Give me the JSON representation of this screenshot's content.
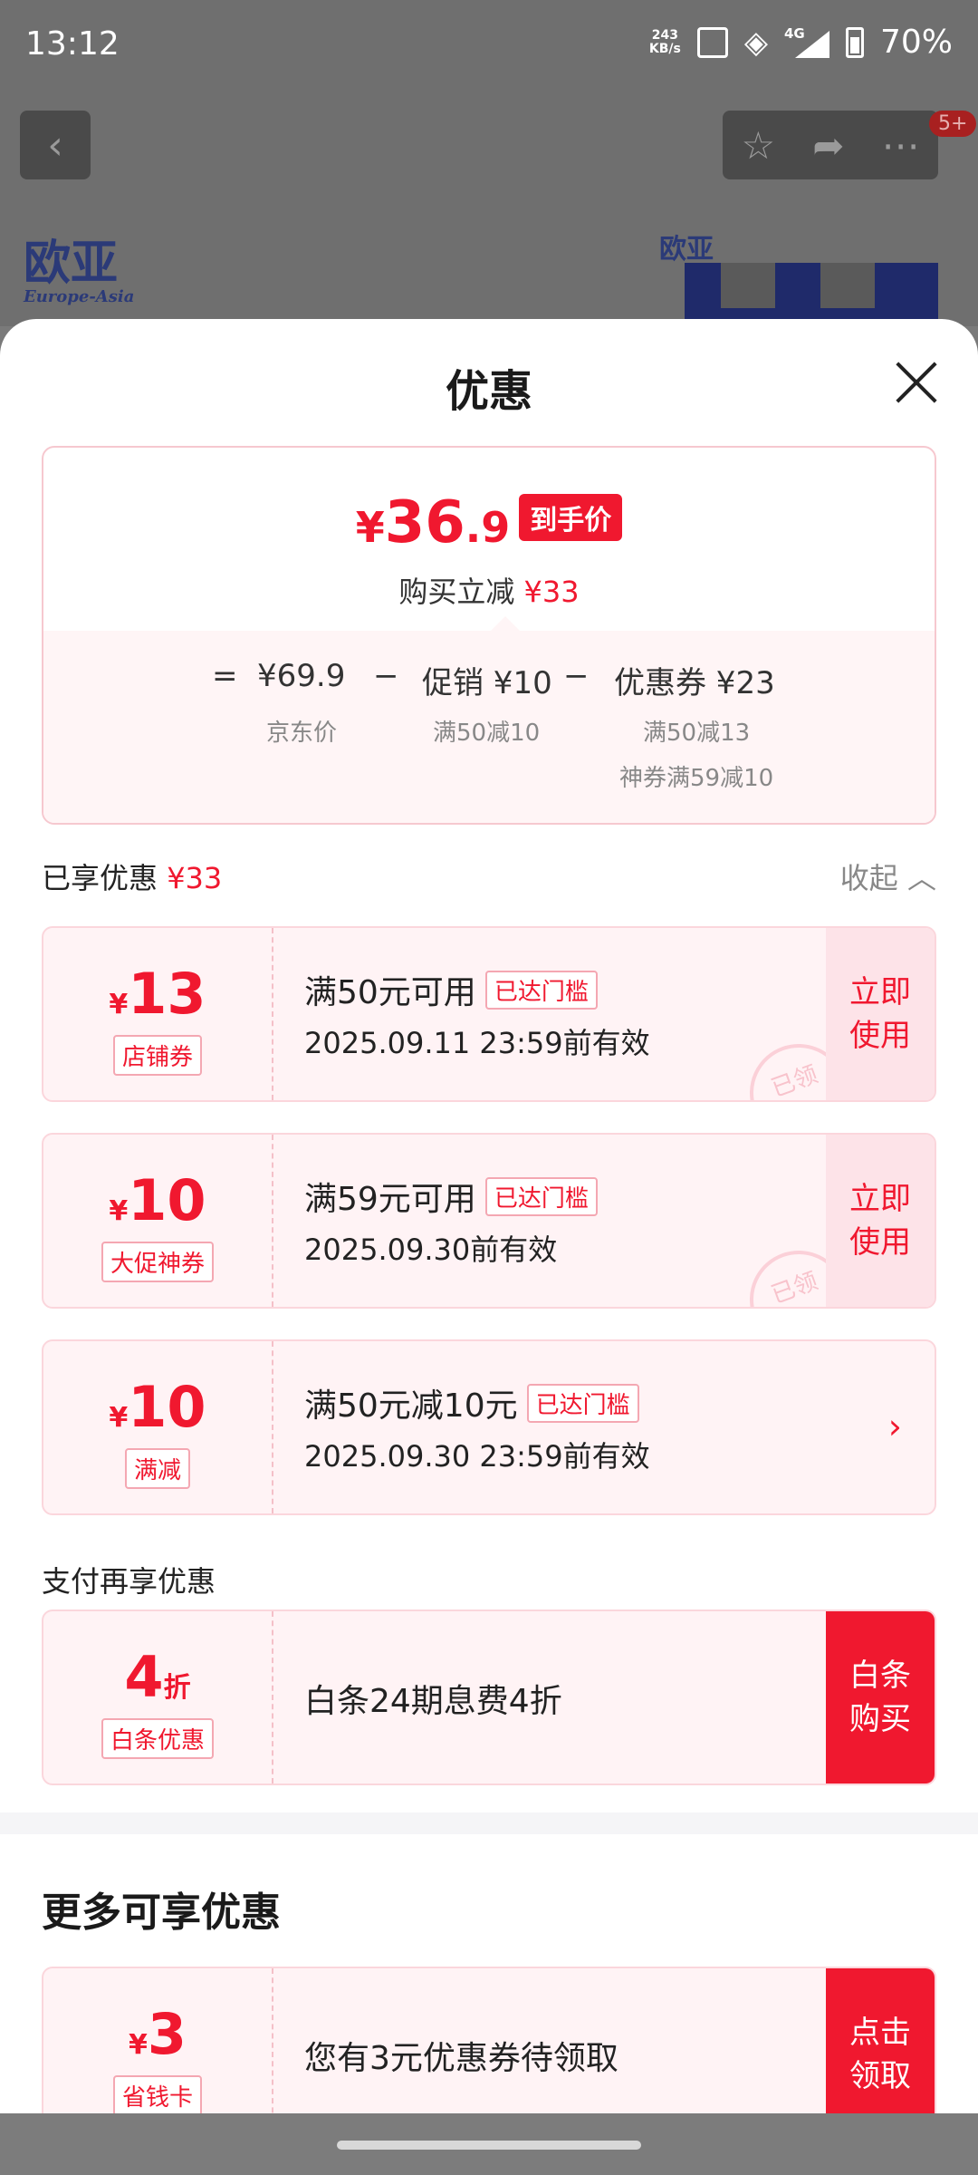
{
  "status": {
    "time": "13:12",
    "net_speed_top": "243",
    "net_speed_bottom": "KB/s",
    "signal_label": "4G",
    "battery": "70%"
  },
  "background": {
    "logo_text": "欧亚",
    "logo_sub": "Europe-Asia",
    "badge": "5+"
  },
  "sheet": {
    "title": "优惠"
  },
  "price": {
    "yen": "¥",
    "final_int": "36",
    "final_dec": ".9",
    "tag": "到手价",
    "sub_prefix": "购买立减",
    "sub_amount": "¥33",
    "eq": "=",
    "base": "¥69.9",
    "base_label": "京东价",
    "minus": "−",
    "promo": "促销 ¥10",
    "promo_label": "满50减10",
    "coupon": "优惠券 ¥23",
    "coupon_label1": "满50减13",
    "coupon_label2": "神券满59减10"
  },
  "enjoyed": {
    "label": "已享优惠",
    "amount": "¥33",
    "collapse": "收起"
  },
  "coupons": [
    {
      "yen": "¥",
      "amount": "13",
      "type": "店铺券",
      "condition": "满50元可用",
      "badge": "已达门槛",
      "date": "2025.09.11 23:59前有效",
      "action_1": "立即",
      "action_2": "使用",
      "stamp": "已领"
    },
    {
      "yen": "¥",
      "amount": "10",
      "type": "大促神券",
      "condition": "满59元可用",
      "badge": "已达门槛",
      "date": "2025.09.30前有效",
      "action_1": "立即",
      "action_2": "使用",
      "stamp": "已领"
    },
    {
      "yen": "¥",
      "amount": "10",
      "type": "满减",
      "condition": "满50元减10元",
      "badge": "已达门槛",
      "date": "2025.09.30 23:59前有效",
      "arrow": "›"
    }
  ],
  "pay_section": {
    "label": "支付再享优惠",
    "amount": "4",
    "unit": "折",
    "type": "白条优惠",
    "text": "白条24期息费4折",
    "action_1": "白条",
    "action_2": "购买"
  },
  "more": {
    "title": "更多可享优惠",
    "yen": "¥",
    "amount": "3",
    "type": "省钱卡",
    "text": "您有3元优惠券待领取",
    "action_1": "点击",
    "action_2": "领取"
  },
  "colors": {
    "accent": "#f0182f",
    "coupon_bg": "#fff3f5"
  }
}
